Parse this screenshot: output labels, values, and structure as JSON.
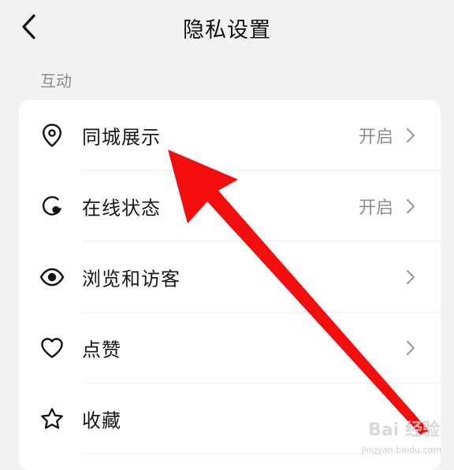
{
  "header": {
    "title": "隐私设置"
  },
  "section": {
    "label": "互动"
  },
  "rows": [
    {
      "label": "同城展示",
      "value": "开启",
      "icon": "location-pin-icon"
    },
    {
      "label": "在线状态",
      "value": "开启",
      "icon": "online-status-icon"
    },
    {
      "label": "浏览和访客",
      "value": "",
      "icon": "eye-icon"
    },
    {
      "label": "点赞",
      "value": "",
      "icon": "heart-icon"
    },
    {
      "label": "收藏",
      "value": "",
      "icon": "star-icon"
    }
  ],
  "annotation": {
    "color": "#f30d0d"
  },
  "watermark": {
    "brand": "Bai 经验",
    "url": "jingyan.baidu.com"
  }
}
